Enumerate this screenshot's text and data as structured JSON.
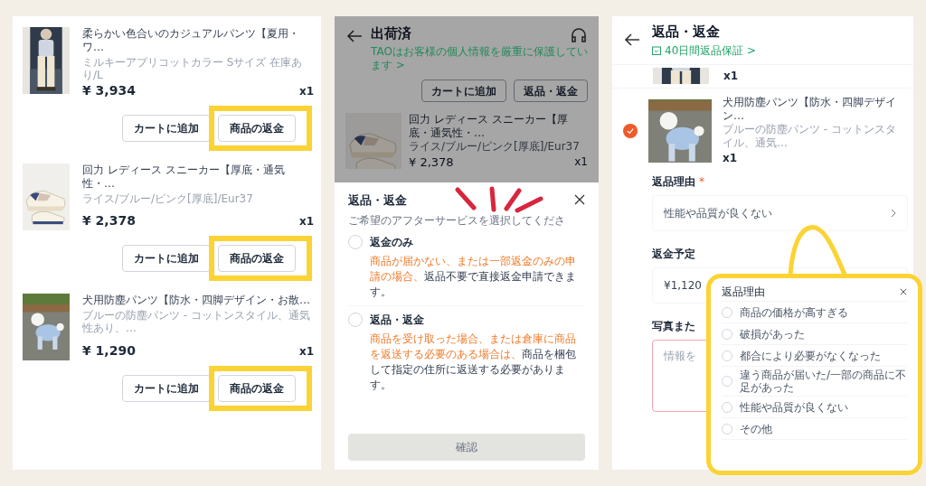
{
  "order_list": {
    "items": [
      {
        "title": "柔らかい色合いのカジュアルパンツ【夏用・ワ…",
        "variant": "ミルキーアプリコットカラー Sサイズ 在庫あり/L",
        "price": "¥ 3,934",
        "quantity": "x1",
        "buttons": [
          {
            "label": "カートに追加"
          },
          {
            "label": "商品の返金",
            "highlighted": true
          }
        ]
      },
      {
        "title": "回力 レディース スニーカー【厚底・通気性・…",
        "variant": "ライス/ブルー/ピンク[厚底]/Eur37",
        "price": "¥ 2,378",
        "quantity": "x1",
        "buttons": [
          {
            "label": "カートに追加"
          },
          {
            "label": "商品の返金",
            "highlighted": true
          }
        ]
      },
      {
        "title": "犬用防塵パンツ【防水・四脚デザイン・お散…",
        "variant": "ブルーの防塵パンツ - コットンスタイル、通気性あり、…",
        "price": "¥ 1,290",
        "quantity": "x1",
        "buttons": [
          {
            "label": "カートに追加"
          },
          {
            "label": "商品の返金",
            "highlighted": true
          }
        ]
      }
    ]
  },
  "shipped_screen": {
    "title": "出荷済",
    "notice": "TAOはお客様の個人情報を厳重に保護しています >",
    "buttons": [
      "カートに追加",
      "返品・返金"
    ],
    "item": {
      "title": "回力 レディース スニーカー【厚底・通気性・…",
      "variant": "ライス/ブルー/ピンク[厚底]/Eur37",
      "price": "¥ 2,378",
      "quantity": "x1"
    },
    "sheet": {
      "title": "返品・返金",
      "subtitle": "ご希望のアフターサービスを選択してくださ",
      "options": [
        {
          "label": "返金のみ",
          "highlight": "商品が届かない、または一部返金のみの申請の場合、",
          "text": "返品不要で直接返金申請できます。",
          "selected": false
        },
        {
          "label": "返品・返金",
          "highlight": "商品を受け取った場合、または倉庫に商品を返送する必要のある場合は、",
          "text": "商品を梱包して指定の住所に返送する必要があります。",
          "selected": false
        }
      ],
      "confirm": {
        "label": "確認",
        "disabled": true
      }
    }
  },
  "return_screen": {
    "title": "返品・返金",
    "guarantee": "40日間返品保証 >",
    "partial_item": {
      "quantity": "x1"
    },
    "item": {
      "title": "犬用防塵パンツ【防水・四脚デザイン…",
      "variant": "ブルーの防塵パンツ - コットンスタイル、通気…",
      "quantity": "x1",
      "checked": true
    },
    "reason": {
      "label": "返品理由",
      "required_mark": "*",
      "value": "性能や品質が良くない"
    },
    "refund": {
      "label": "返金予定",
      "amount": "¥1,120"
    },
    "photos": {
      "label": "写真また",
      "placeholder": "情報を"
    },
    "reason_popup": {
      "title": "返品理由",
      "options": [
        {
          "label": "商品の価格が高すぎる",
          "selected": false
        },
        {
          "label": "破損があった",
          "selected": false
        },
        {
          "label": "都合により必要がなくなった",
          "selected": false
        },
        {
          "label": "違う商品が届いた/一部の商品に不足があった",
          "selected": false
        },
        {
          "label": "性能や品質が良くない",
          "selected": false
        },
        {
          "label": "その他",
          "selected": false
        }
      ]
    }
  }
}
